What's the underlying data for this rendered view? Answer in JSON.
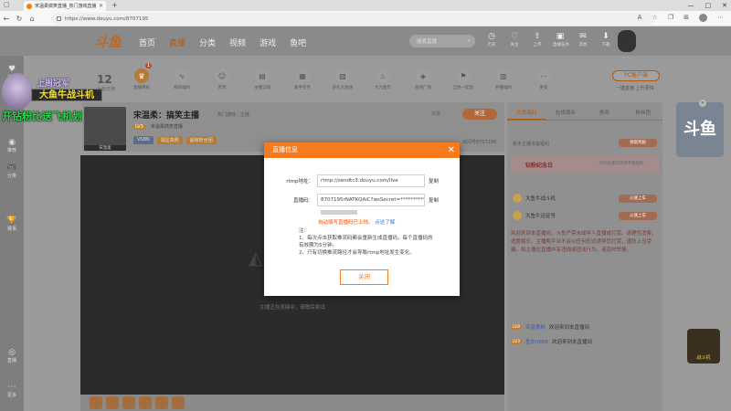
{
  "browser": {
    "tab_title": "宋温柔搞笑直播_热门游戏直播 - 斗鱼",
    "new_tab": "+",
    "url": "https://www.douyu.com/8707195",
    "window_controls": [
      "—",
      "□",
      "✕"
    ]
  },
  "header": {
    "logo": "斗鱼",
    "nav": [
      "首页",
      "直播",
      "分类",
      "视频",
      "游戏",
      "鱼吧"
    ],
    "search_placeholder": "搜索直播",
    "icons": [
      {
        "icon": "history-icon",
        "label": "历史"
      },
      {
        "icon": "follow-icon",
        "label": "关注"
      },
      {
        "icon": "upload-icon",
        "label": "上传"
      },
      {
        "icon": "task-icon",
        "label": "直播任务"
      },
      {
        "icon": "message-icon",
        "label": "消息"
      },
      {
        "icon": "download-icon",
        "label": "下载"
      }
    ]
  },
  "sidebar": {
    "items": [
      {
        "icon": "heart-icon",
        "label": "关注"
      },
      {
        "icon": "live-icon",
        "label": "推荐"
      },
      {
        "icon": "game-icon",
        "label": "分类"
      },
      {
        "icon": "trophy-icon",
        "label": "赛事"
      },
      {
        "icon": "recommend-icon",
        "label": "直播"
      },
      {
        "icon": "more-icon",
        "label": "更多"
      }
    ]
  },
  "promo": {
    "title": "上周冠军",
    "badge": "大鱼牛战斗机",
    "caption": "开钻粉比送飞机划算"
  },
  "categories": {
    "day_number": "12",
    "day_label": "大鱼日常",
    "items": [
      {
        "label": "直播特权",
        "badge": "1"
      },
      {
        "label": "每日福利"
      },
      {
        "label": "贵宾"
      },
      {
        "label": "主播订阅"
      },
      {
        "label": "新手任务"
      },
      {
        "label": "好礼大放送"
      },
      {
        "label": "大力金币"
      },
      {
        "label": "鱼吧广场"
      },
      {
        "label": "全民一起玩"
      },
      {
        "label": "开播福利"
      },
      {
        "label": "更多"
      }
    ],
    "pc_button": "PC客户端",
    "pc_sub": "一键直播 上升更快"
  },
  "streamer": {
    "title": "宋温柔：搞笑主播",
    "meta": "热门游戏 · 主播",
    "tag": "LV3",
    "sub": "宋温柔搞笑直播",
    "badges": [
      "VSBN",
      "福星高照",
      "超级粉丝团"
    ],
    "follow": "关注",
    "report": "举报",
    "room_no": "房间号8707195",
    "avatar_label": "宋温柔"
  },
  "video": {
    "message": "主播正在连接中，请稍后尝试"
  },
  "right_panel": {
    "tabs": [
      "日常福利",
      "在线观众",
      "贵宾",
      "粉丝团"
    ],
    "top_text": "新手主播专属福利",
    "top_btn": "领取奖励",
    "section_title": "钻粉纪念日",
    "section_sub": "今日开通可获得专属福利",
    "rows": [
      {
        "label": "大鱼牛战斗机",
        "btn": "火速上车"
      },
      {
        "label": "大鱼牛远征号",
        "btn": "火速上车"
      }
    ],
    "notice": "欢迎来到本直播间，斗鱼严禁未成年人直播或打赏。请理性消费，适度娱乐，主播和平台不会以任何形式诱导您打赏，谨防上当受骗。如主播在直播中有违规或违法行为，请及时举报。",
    "chat": [
      {
        "level": "LV8",
        "name": "宋温柔粉",
        "text": "欢迎来到本直播间"
      },
      {
        "level": "LV3",
        "name": "鱼友0686",
        "text": "欢迎来到本直播间"
      }
    ]
  },
  "ads": {
    "top": "斗鱼",
    "bottom": "战斗机"
  },
  "modal": {
    "title": "直播信息",
    "rtmp_label": "rtmp地址：",
    "rtmp_value": "rtmp://sendtc3.douyu.com/live",
    "key_label": "直播码：",
    "key_value": "8707195rNATKQAiC?wsSecret=**********",
    "copy": "复制",
    "hint": "自动填写直播码已上线。",
    "hint_link": "点这了解",
    "notes_title": "注：",
    "note1": "1、每次点击获取推流码都会重新生成直播码，每个直播码的有效期为5分钟。",
    "note2": "2、只有切换推流路径才会导致rtmp地址发生变化。",
    "close_btn": "关闭",
    "close_icon": "✕"
  }
}
